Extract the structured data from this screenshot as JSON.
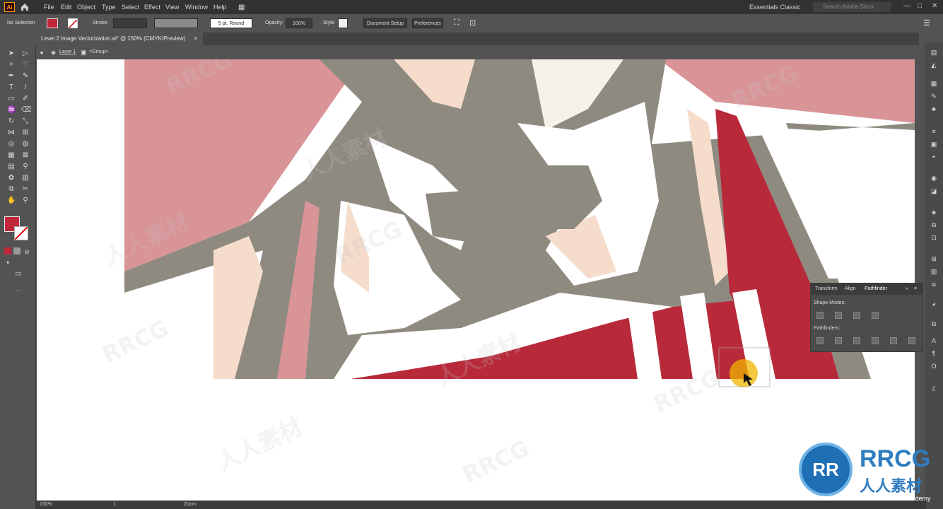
{
  "menubar": {
    "logo": "Ai",
    "items": [
      "File",
      "Edit",
      "Object",
      "Type",
      "Select",
      "Effect",
      "View",
      "Window",
      "Help"
    ],
    "workspace": "Essentials Classic",
    "search_placeholder": "Search Adobe Stock"
  },
  "control": {
    "selection": "No Selection",
    "stroke_label": "Stroke:",
    "brush": "5 pt. Round",
    "opacity_label": "Opacity:",
    "opacity_value": "100%",
    "style_label": "Style:",
    "document_setup": "Document Setup",
    "preferences": "Preferences"
  },
  "document_tab": {
    "title": "Level 2 Image Vectorization.ai* @ 150% (CMYK/Preview)",
    "close": "×"
  },
  "breadcrumb": {
    "layer": "Layer 1",
    "group": "<Group>"
  },
  "panel": {
    "tabs": [
      "Transform",
      "Align",
      "Pathfinder"
    ],
    "shape_modes": "Shape Modes:",
    "pathfinders": "Pathfinders:"
  },
  "status": {
    "zoom": "150%",
    "artboard": "1",
    "mode": "Zoom"
  },
  "watermark": {
    "text_en": "RRCG",
    "text_cn": "人人素材"
  },
  "brand": {
    "logo_letters": "RR",
    "name": "RRCG",
    "cn": "人人素材",
    "udemy": "Udemy"
  },
  "colors": {
    "fill": "#c0283a",
    "pink": "#d99498",
    "gray": "#8f8a80",
    "cream": "#f5dccb",
    "red": "#b8293a"
  }
}
